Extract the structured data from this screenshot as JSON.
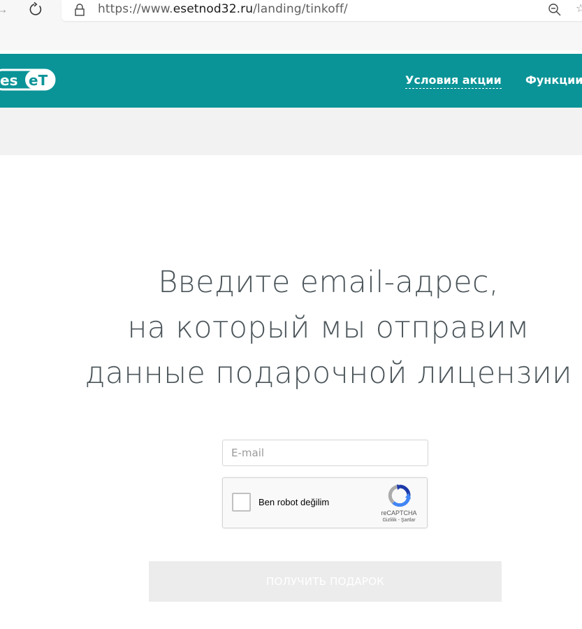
{
  "browser": {
    "url_scheme": "https://www.",
    "url_host": "esetnod32.ru",
    "url_path": "/landing/tinkoff/"
  },
  "header": {
    "logo_text": "eset",
    "nav": [
      {
        "label": "Условия акции"
      },
      {
        "label": "Функции"
      }
    ],
    "background_color": "#0b9497"
  },
  "main": {
    "heading_lines": [
      "Введите email-адрес,",
      "на который мы отправим",
      "данные подарочной лицензии"
    ],
    "email_placeholder": "E-mail",
    "email_value": "",
    "recaptcha": {
      "label": "Ben robot değilim",
      "brand": "reCAPTCHA",
      "terms": "Gizlilik - Şartlar",
      "checked": false
    },
    "submit_label": "ПОЛУЧИТЬ ПОДАРОК"
  },
  "icons": {
    "back": "back-arrow-icon",
    "reload": "reload-icon",
    "lock": "lock-icon",
    "zoom": "zoom-out-icon",
    "favorite": "star-icon",
    "recaptcha": "recaptcha-logo-icon"
  }
}
